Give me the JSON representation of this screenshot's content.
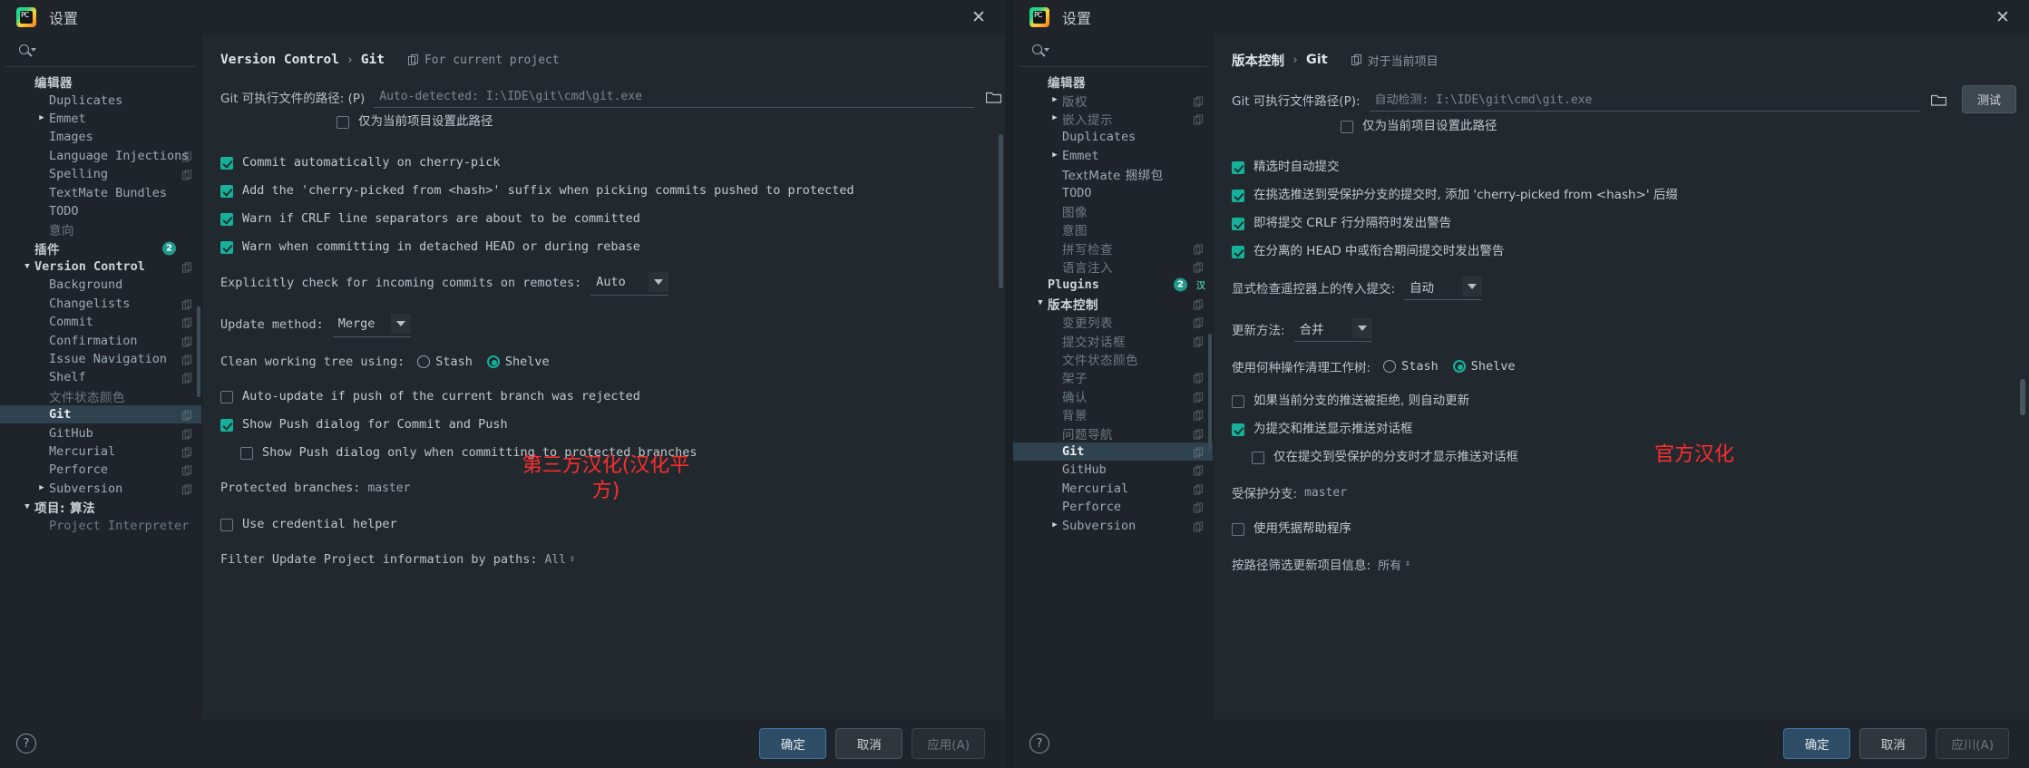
{
  "window_left": {
    "title": "设置",
    "close_label": "✕",
    "search_placeholder": "",
    "sidebar": [
      {
        "label": "编辑器",
        "level": "hdr",
        "cjk": true,
        "twisty": "",
        "copy": false
      },
      {
        "label": "Duplicates",
        "level": "lvl1",
        "cjk": false,
        "twisty": "",
        "copy": false
      },
      {
        "label": "Emmet",
        "level": "lvl1",
        "cjk": false,
        "twisty": "▶",
        "copy": false
      },
      {
        "label": "Images",
        "level": "lvl1",
        "cjk": false,
        "twisty": "",
        "copy": false
      },
      {
        "label": "Language Injections",
        "level": "lvl1",
        "cjk": false,
        "twisty": "",
        "copy": true
      },
      {
        "label": "Spelling",
        "level": "lvl1",
        "cjk": false,
        "twisty": "",
        "copy": true
      },
      {
        "label": "TextMate Bundles",
        "level": "lvl1",
        "cjk": false,
        "twisty": "",
        "copy": false
      },
      {
        "label": "TODO",
        "level": "lvl1",
        "cjk": false,
        "twisty": "",
        "copy": false
      },
      {
        "label": "意向",
        "level": "lvl1",
        "cjk": true,
        "twisty": "",
        "copy": false,
        "dim": true
      },
      {
        "label": "插件",
        "level": "hdr",
        "cjk": true,
        "twisty": "",
        "copy": false,
        "badge": "2"
      },
      {
        "label": "Version Control",
        "level": "lvl0b",
        "cjk": false,
        "twisty": "▼",
        "copy": true
      },
      {
        "label": "Background",
        "level": "lvl1",
        "cjk": false,
        "twisty": "",
        "copy": false
      },
      {
        "label": "Changelists",
        "level": "lvl1",
        "cjk": false,
        "twisty": "",
        "copy": true
      },
      {
        "label": "Commit",
        "level": "lvl1",
        "cjk": false,
        "twisty": "",
        "copy": true
      },
      {
        "label": "Confirmation",
        "level": "lvl1",
        "cjk": false,
        "twisty": "",
        "copy": true
      },
      {
        "label": "Issue Navigation",
        "level": "lvl1",
        "cjk": false,
        "twisty": "",
        "copy": true
      },
      {
        "label": "Shelf",
        "level": "lvl1",
        "cjk": false,
        "twisty": "",
        "copy": true
      },
      {
        "label": "文件状态颜色",
        "level": "lvl1",
        "cjk": true,
        "twisty": "",
        "copy": false,
        "dim": true
      },
      {
        "label": "Git",
        "level": "lvl1",
        "cjk": false,
        "twisty": "",
        "copy": true,
        "selected": true
      },
      {
        "label": "GitHub",
        "level": "lvl1",
        "cjk": false,
        "twisty": "",
        "copy": true
      },
      {
        "label": "Mercurial",
        "level": "lvl1",
        "cjk": false,
        "twisty": "",
        "copy": true
      },
      {
        "label": "Perforce",
        "level": "lvl1",
        "cjk": false,
        "twisty": "",
        "copy": true
      },
      {
        "label": "Subversion",
        "level": "lvl1",
        "cjk": false,
        "twisty": "▶",
        "copy": true
      },
      {
        "label": "项目: 算法",
        "level": "lvl0b",
        "cjk": true,
        "twisty": "▼",
        "copy": false
      },
      {
        "label": "Project Interpreter",
        "level": "lvl1",
        "cjk": false,
        "twisty": "",
        "copy": false,
        "dim": true
      }
    ],
    "detail": {
      "breadcrumb_1": "Version Control",
      "breadcrumb_sep": "›",
      "breadcrumb_2": "Git",
      "scope_label": "For current project",
      "path_label": "Git 可执行文件的路径: (P)",
      "path_value": "Auto-detected: I:\\IDE\\git\\cmd\\git.exe",
      "project_only_label": "仅为当前项目设置此路径",
      "project_only_checked": false,
      "cb1_label": "Commit automatically on cherry-pick",
      "cb1_checked": true,
      "cb2_label": "Add the 'cherry-picked from <hash>' suffix when picking commits pushed to protected",
      "cb2_checked": true,
      "cb3_label": "Warn if CRLF line separators are about to be committed",
      "cb3_checked": true,
      "cb4_label": "Warn when committing in detached HEAD or during rebase",
      "cb4_checked": true,
      "explicit_label": "Explicitly check for incoming commits on remotes:",
      "explicit_value": "Auto",
      "update_label": "Update method:",
      "update_value": "Merge",
      "clean_label": "Clean working tree using:",
      "clean_opt1": "Stash",
      "clean_opt2": "Shelve",
      "clean_selected": "Shelve",
      "cb5_label": "Auto-update if push of the current branch was rejected",
      "cb5_checked": false,
      "cb6_label": "Show Push dialog for Commit and Push",
      "cb6_checked": true,
      "cb7_label": "Show Push dialog only when committing to protected branches",
      "cb7_checked": false,
      "protected_label": "Protected branches:",
      "protected_value": "master",
      "cb8_label": "Use credential helper",
      "cb8_checked": false,
      "filter_label": "Filter Update Project information by paths:",
      "filter_value": "All"
    },
    "annotation": "第三方汉化(汉化平方)",
    "footer": {
      "help": "?",
      "ok": "确定",
      "cancel": "取消",
      "apply": "应用(A)"
    }
  },
  "window_right": {
    "title": "设置",
    "close_label": "✕",
    "search_placeholder": "",
    "sidebar": [
      {
        "label": "编辑器",
        "level": "hdr",
        "cjk": true,
        "twisty": "",
        "copy": false
      },
      {
        "label": "版权",
        "level": "lvl1",
        "cjk": true,
        "twisty": "▶",
        "copy": true,
        "dim": true
      },
      {
        "label": "嵌入提示",
        "level": "lvl1",
        "cjk": true,
        "twisty": "▶",
        "copy": true,
        "dim": true
      },
      {
        "label": "Duplicates",
        "level": "lvl1",
        "cjk": false,
        "twisty": "",
        "copy": false
      },
      {
        "label": "Emmet",
        "level": "lvl1",
        "cjk": false,
        "twisty": "▶",
        "copy": false
      },
      {
        "label": "TextMate 捆绑包",
        "level": "lvl1",
        "cjk": true,
        "twisty": "",
        "copy": false
      },
      {
        "label": "TODO",
        "level": "lvl1",
        "cjk": false,
        "twisty": "",
        "copy": false
      },
      {
        "label": "图像",
        "level": "lvl1",
        "cjk": true,
        "twisty": "",
        "copy": false,
        "dim": true
      },
      {
        "label": "意图",
        "level": "lvl1",
        "cjk": true,
        "twisty": "",
        "copy": false,
        "dim": true
      },
      {
        "label": "拼写检查",
        "level": "lvl1",
        "cjk": true,
        "twisty": "",
        "copy": true,
        "dim": true
      },
      {
        "label": "语言注入",
        "level": "lvl1",
        "cjk": true,
        "twisty": "",
        "copy": true,
        "dim": true
      },
      {
        "label": "Plugins",
        "level": "lvl0b",
        "cjk": false,
        "twisty": "",
        "copy": false,
        "badge": "2",
        "plug": true
      },
      {
        "label": "版本控制",
        "level": "lvl0b",
        "cjk": true,
        "twisty": "▼",
        "copy": true
      },
      {
        "label": "变更列表",
        "level": "lvl1",
        "cjk": true,
        "twisty": "",
        "copy": true,
        "dim": true
      },
      {
        "label": "提交对话框",
        "level": "lvl1",
        "cjk": true,
        "twisty": "",
        "copy": true,
        "dim": true
      },
      {
        "label": "文件状态颜色",
        "level": "lvl1",
        "cjk": true,
        "twisty": "",
        "copy": false,
        "dim": true
      },
      {
        "label": "架子",
        "level": "lvl1",
        "cjk": true,
        "twisty": "",
        "copy": true,
        "dim": true
      },
      {
        "label": "确认",
        "level": "lvl1",
        "cjk": true,
        "twisty": "",
        "copy": true,
        "dim": true
      },
      {
        "label": "背景",
        "level": "lvl1",
        "cjk": true,
        "twisty": "",
        "copy": true,
        "dim": true
      },
      {
        "label": "问题导航",
        "level": "lvl1",
        "cjk": true,
        "twisty": "",
        "copy": true,
        "dim": true
      },
      {
        "label": "Git",
        "level": "lvl1",
        "cjk": false,
        "twisty": "",
        "copy": true,
        "selected": true
      },
      {
        "label": "GitHub",
        "level": "lvl1",
        "cjk": false,
        "twisty": "",
        "copy": true
      },
      {
        "label": "Mercurial",
        "level": "lvl1",
        "cjk": false,
        "twisty": "",
        "copy": true
      },
      {
        "label": "Perforce",
        "level": "lvl1",
        "cjk": false,
        "twisty": "",
        "copy": true
      },
      {
        "label": "Subversion",
        "level": "lvl1",
        "cjk": false,
        "twisty": "▶",
        "copy": true
      }
    ],
    "detail": {
      "breadcrumb_1": "版本控制",
      "breadcrumb_sep": "›",
      "breadcrumb_2": "Git",
      "scope_label": "对于当前项目",
      "path_label": "Git 可执行文件路径(P):",
      "path_value": "自动检测: I:\\IDE\\git\\cmd\\git.exe",
      "test_button": "测试",
      "project_only_label": "仅为当前项目设置此路径",
      "project_only_checked": false,
      "cb1_label": "精选时自动提交",
      "cb1_checked": true,
      "cb2_label": "在挑选推送到受保护分支的提交时, 添加 'cherry-picked from <hash>' 后缀",
      "cb2_checked": true,
      "cb3_label": "即将提交 CRLF 行分隔符时发出警告",
      "cb3_checked": true,
      "cb4_label": "在分离的 HEAD 中或衔合期间提交时发出警告",
      "cb4_checked": true,
      "explicit_label": "显式检查遥控器上的传入提交:",
      "explicit_value": "自动",
      "update_label": "更新方法:",
      "update_value": "合并",
      "clean_label": "使用何种操作清理工作树:",
      "clean_opt1": "Stash",
      "clean_opt2": "Shelve",
      "clean_selected": "Shelve",
      "cb5_label": "如果当前分支的推送被拒绝, 则自动更新",
      "cb5_checked": false,
      "cb6_label": "为提交和推送显示推送对话框",
      "cb6_checked": true,
      "cb7_label": "仅在提交到受保护的分支时才显示推送对话框",
      "cb7_checked": false,
      "protected_label": "受保护分支:",
      "protected_value": "master",
      "cb8_label": "使用凭据帮助程序",
      "cb8_checked": false,
      "filter_label": "按路径筛选更新项目信息:",
      "filter_value": "所有"
    },
    "annotation": "官方汉化",
    "footer": {
      "help": "?",
      "ok": "确定",
      "cancel": "取消",
      "apply": "应川(A)"
    }
  },
  "colors": {
    "accent_teal": "#17b09a",
    "selection_blue": "#2f4250",
    "annotation_red": "#ff2d2d",
    "panel_bg": "#22292e",
    "window_bg": "#1e2429"
  }
}
